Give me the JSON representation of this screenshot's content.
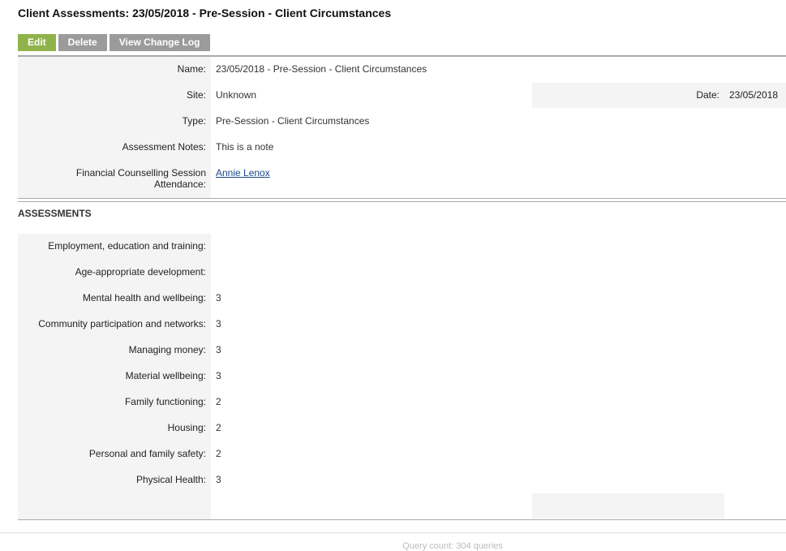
{
  "page_title": "Client Assessments: 23/05/2018 - Pre-Session - Client Circumstances",
  "buttons": {
    "edit": "Edit",
    "delete": "Delete",
    "change_log": "View Change Log"
  },
  "details": {
    "name_label": "Name:",
    "name_value": "23/05/2018 - Pre-Session - Client Circumstances",
    "site_label": "Site:",
    "site_value": "Unknown",
    "date_label": "Date:",
    "date_value": "23/05/2018",
    "type_label": "Type:",
    "type_value": "Pre-Session - Client Circumstances",
    "notes_label": "Assessment Notes:",
    "notes_value": "This is a note",
    "attendance_label_1": "Financial Counselling Session",
    "attendance_label_2": "Attendance:",
    "attendance_value": "Annie Lenox"
  },
  "assessments": {
    "heading": "ASSESSMENTS",
    "items": [
      {
        "label": "Employment, education and training:",
        "value": ""
      },
      {
        "label": "Age-appropriate development:",
        "value": ""
      },
      {
        "label": "Mental health and wellbeing:",
        "value": "3"
      },
      {
        "label": "Community participation and networks:",
        "value": "3"
      },
      {
        "label": "Managing money:",
        "value": "3"
      },
      {
        "label": "Material wellbeing:",
        "value": "3"
      },
      {
        "label": "Family functioning:",
        "value": "2"
      },
      {
        "label": "Housing:",
        "value": "2"
      },
      {
        "label": "Personal and family safety:",
        "value": "2"
      },
      {
        "label": "Physical Health:",
        "value": "3"
      }
    ]
  },
  "footer": "Query count: 304 queries"
}
